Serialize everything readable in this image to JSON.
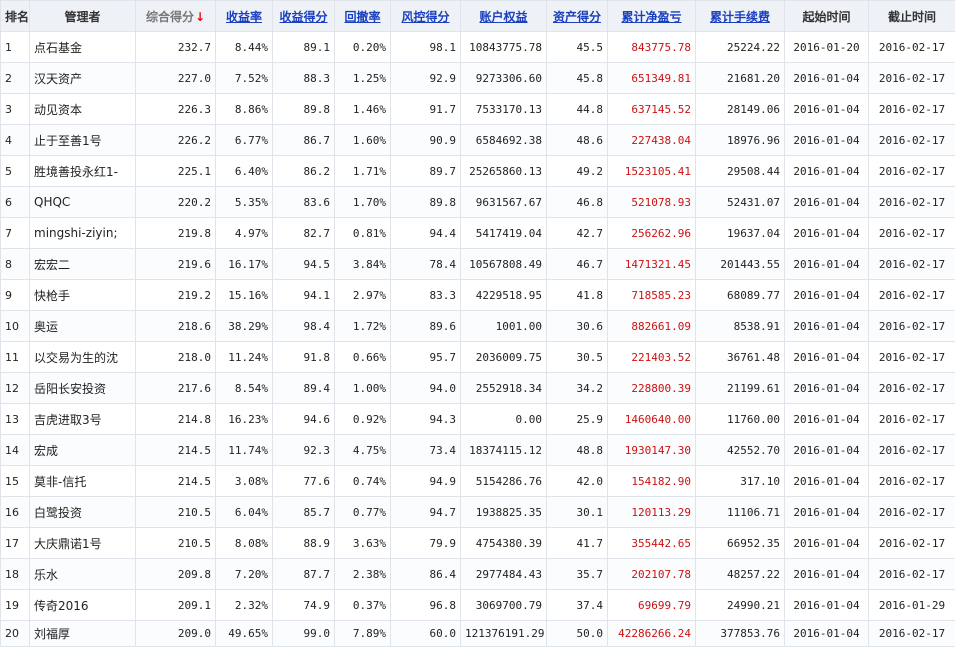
{
  "colors": {
    "accent_link": "#1a3fbf",
    "profit_red": "#cc1111",
    "header_bg": "#eef1f6"
  },
  "headers": {
    "rank": "排名",
    "manager": "管理者",
    "score": "综合得分",
    "sort_icon": "arrow-down-icon",
    "return_rate": "收益率",
    "return_score": "收益得分",
    "drawdown": "回撤率",
    "risk_score": "风控得分",
    "equity": "账户权益",
    "asset_score": "资产得分",
    "net_profit": "累计净盈亏",
    "fees": "累计手续费",
    "start_time": "起始时间",
    "end_time": "截止时间"
  },
  "rows": [
    {
      "rank": "1",
      "manager": "点石基金",
      "score": "232.7",
      "return_rate": "8.44%",
      "return_score": "89.1",
      "drawdown": "0.20%",
      "risk_score": "98.1",
      "equity": "10843775.78",
      "asset_score": "45.5",
      "net_profit": "843775.78",
      "fees": "25224.22",
      "start": "2016-01-20",
      "end": "2016-02-17"
    },
    {
      "rank": "2",
      "manager": "汉天资产",
      "score": "227.0",
      "return_rate": "7.52%",
      "return_score": "88.3",
      "drawdown": "1.25%",
      "risk_score": "92.9",
      "equity": "9273306.60",
      "asset_score": "45.8",
      "net_profit": "651349.81",
      "fees": "21681.20",
      "start": "2016-01-04",
      "end": "2016-02-17"
    },
    {
      "rank": "3",
      "manager": "动见资本",
      "score": "226.3",
      "return_rate": "8.86%",
      "return_score": "89.8",
      "drawdown": "1.46%",
      "risk_score": "91.7",
      "equity": "7533170.13",
      "asset_score": "44.8",
      "net_profit": "637145.52",
      "fees": "28149.06",
      "start": "2016-01-04",
      "end": "2016-02-17"
    },
    {
      "rank": "4",
      "manager": "止于至善1号",
      "score": "226.2",
      "return_rate": "6.77%",
      "return_score": "86.7",
      "drawdown": "1.60%",
      "risk_score": "90.9",
      "equity": "6584692.38",
      "asset_score": "48.6",
      "net_profit": "227438.04",
      "fees": "18976.96",
      "start": "2016-01-04",
      "end": "2016-02-17"
    },
    {
      "rank": "5",
      "manager": "胜境善投永红1-",
      "score": "225.1",
      "return_rate": "6.40%",
      "return_score": "86.2",
      "drawdown": "1.71%",
      "risk_score": "89.7",
      "equity": "25265860.13",
      "asset_score": "49.2",
      "net_profit": "1523105.41",
      "fees": "29508.44",
      "start": "2016-01-04",
      "end": "2016-02-17"
    },
    {
      "rank": "6",
      "manager": "QHQC",
      "score": "220.2",
      "return_rate": "5.35%",
      "return_score": "83.6",
      "drawdown": "1.70%",
      "risk_score": "89.8",
      "equity": "9631567.67",
      "asset_score": "46.8",
      "net_profit": "521078.93",
      "fees": "52431.07",
      "start": "2016-01-04",
      "end": "2016-02-17"
    },
    {
      "rank": "7",
      "manager": "mingshi-ziyin;",
      "score": "219.8",
      "return_rate": "4.97%",
      "return_score": "82.7",
      "drawdown": "0.81%",
      "risk_score": "94.4",
      "equity": "5417419.04",
      "asset_score": "42.7",
      "net_profit": "256262.96",
      "fees": "19637.04",
      "start": "2016-01-04",
      "end": "2016-02-17"
    },
    {
      "rank": "8",
      "manager": "宏宏二",
      "score": "219.6",
      "return_rate": "16.17%",
      "return_score": "94.5",
      "drawdown": "3.84%",
      "risk_score": "78.4",
      "equity": "10567808.49",
      "asset_score": "46.7",
      "net_profit": "1471321.45",
      "fees": "201443.55",
      "start": "2016-01-04",
      "end": "2016-02-17"
    },
    {
      "rank": "9",
      "manager": "快枪手",
      "score": "219.2",
      "return_rate": "15.16%",
      "return_score": "94.1",
      "drawdown": "2.97%",
      "risk_score": "83.3",
      "equity": "4229518.95",
      "asset_score": "41.8",
      "net_profit": "718585.23",
      "fees": "68089.77",
      "start": "2016-01-04",
      "end": "2016-02-17"
    },
    {
      "rank": "10",
      "manager": "奥运",
      "score": "218.6",
      "return_rate": "38.29%",
      "return_score": "98.4",
      "drawdown": "1.72%",
      "risk_score": "89.6",
      "equity": "1001.00",
      "asset_score": "30.6",
      "net_profit": "882661.09",
      "fees": "8538.91",
      "start": "2016-01-04",
      "end": "2016-02-17"
    },
    {
      "rank": "11",
      "manager": "以交易为生的沈",
      "score": "218.0",
      "return_rate": "11.24%",
      "return_score": "91.8",
      "drawdown": "0.66%",
      "risk_score": "95.7",
      "equity": "2036009.75",
      "asset_score": "30.5",
      "net_profit": "221403.52",
      "fees": "36761.48",
      "start": "2016-01-04",
      "end": "2016-02-17"
    },
    {
      "rank": "12",
      "manager": "岳阳长安投资",
      "score": "217.6",
      "return_rate": "8.54%",
      "return_score": "89.4",
      "drawdown": "1.00%",
      "risk_score": "94.0",
      "equity": "2552918.34",
      "asset_score": "34.2",
      "net_profit": "228800.39",
      "fees": "21199.61",
      "start": "2016-01-04",
      "end": "2016-02-17"
    },
    {
      "rank": "13",
      "manager": "吉虎进取3号",
      "score": "214.8",
      "return_rate": "16.23%",
      "return_score": "94.6",
      "drawdown": "0.92%",
      "risk_score": "94.3",
      "equity": "0.00",
      "asset_score": "25.9",
      "net_profit": "1460640.00",
      "fees": "11760.00",
      "start": "2016-01-04",
      "end": "2016-02-17"
    },
    {
      "rank": "14",
      "manager": "宏成",
      "score": "214.5",
      "return_rate": "11.74%",
      "return_score": "92.3",
      "drawdown": "4.75%",
      "risk_score": "73.4",
      "equity": "18374115.12",
      "asset_score": "48.8",
      "net_profit": "1930147.30",
      "fees": "42552.70",
      "start": "2016-01-04",
      "end": "2016-02-17"
    },
    {
      "rank": "15",
      "manager": "莫非-信托",
      "score": "214.5",
      "return_rate": "3.08%",
      "return_score": "77.6",
      "drawdown": "0.74%",
      "risk_score": "94.9",
      "equity": "5154286.76",
      "asset_score": "42.0",
      "net_profit": "154182.90",
      "fees": "317.10",
      "start": "2016-01-04",
      "end": "2016-02-17"
    },
    {
      "rank": "16",
      "manager": "白鹭投资",
      "score": "210.5",
      "return_rate": "6.04%",
      "return_score": "85.7",
      "drawdown": "0.77%",
      "risk_score": "94.7",
      "equity": "1938825.35",
      "asset_score": "30.1",
      "net_profit": "120113.29",
      "fees": "11106.71",
      "start": "2016-01-04",
      "end": "2016-02-17"
    },
    {
      "rank": "17",
      "manager": "大庆鼎诺1号",
      "score": "210.5",
      "return_rate": "8.08%",
      "return_score": "88.9",
      "drawdown": "3.63%",
      "risk_score": "79.9",
      "equity": "4754380.39",
      "asset_score": "41.7",
      "net_profit": "355442.65",
      "fees": "66952.35",
      "start": "2016-01-04",
      "end": "2016-02-17"
    },
    {
      "rank": "18",
      "manager": "乐水",
      "score": "209.8",
      "return_rate": "7.20%",
      "return_score": "87.7",
      "drawdown": "2.38%",
      "risk_score": "86.4",
      "equity": "2977484.43",
      "asset_score": "35.7",
      "net_profit": "202107.78",
      "fees": "48257.22",
      "start": "2016-01-04",
      "end": "2016-02-17"
    },
    {
      "rank": "19",
      "manager": "传奇2016",
      "score": "209.1",
      "return_rate": "2.32%",
      "return_score": "74.9",
      "drawdown": "0.37%",
      "risk_score": "96.8",
      "equity": "3069700.79",
      "asset_score": "37.4",
      "net_profit": "69699.79",
      "fees": "24990.21",
      "start": "2016-01-04",
      "end": "2016-01-29"
    },
    {
      "rank": "20",
      "manager": "刘福厚",
      "score": "209.0",
      "return_rate": "49.65%",
      "return_score": "99.0",
      "drawdown": "7.89%",
      "risk_score": "60.0",
      "equity": "121376191.29",
      "asset_score": "50.0",
      "net_profit": "42286266.24",
      "fees": "377853.76",
      "start": "2016-01-04",
      "end": "2016-02-17"
    }
  ]
}
